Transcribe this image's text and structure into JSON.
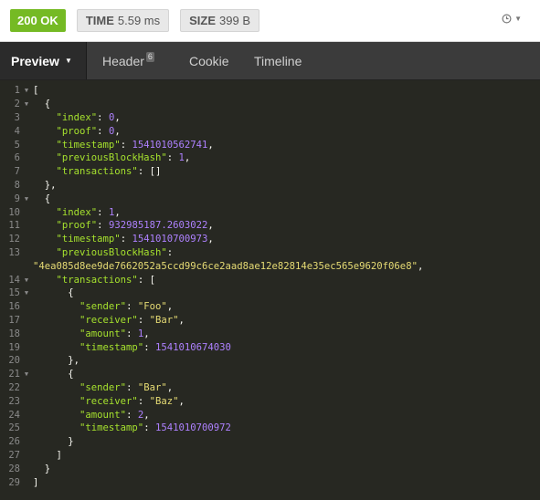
{
  "status": {
    "code_label": "200 OK"
  },
  "time": {
    "label": "TIME",
    "value": "5.59 ms"
  },
  "size": {
    "label": "SIZE",
    "value": "399 B"
  },
  "history_icon": "clock-icon",
  "tabs": {
    "preview": "Preview",
    "header": "Header",
    "header_count": "6",
    "cookie": "Cookie",
    "timeline": "Timeline"
  },
  "colors": {
    "status_ok": "#75ba24",
    "key": "#a6e22e",
    "number": "#ae81ff",
    "string": "#e6db74",
    "background": "#272822"
  },
  "json_lines": [
    {
      "n": "1",
      "fold": true,
      "t": [
        [
          "p",
          "["
        ]
      ]
    },
    {
      "n": "2",
      "fold": true,
      "t": [
        [
          "p",
          "  {"
        ]
      ]
    },
    {
      "n": "3",
      "fold": false,
      "t": [
        [
          "p",
          "    "
        ],
        [
          "k",
          "\"index\""
        ],
        [
          "p",
          ": "
        ],
        [
          "n",
          "0"
        ],
        [
          "p",
          ","
        ]
      ]
    },
    {
      "n": "4",
      "fold": false,
      "t": [
        [
          "p",
          "    "
        ],
        [
          "k",
          "\"proof\""
        ],
        [
          "p",
          ": "
        ],
        [
          "n",
          "0"
        ],
        [
          "p",
          ","
        ]
      ]
    },
    {
      "n": "5",
      "fold": false,
      "t": [
        [
          "p",
          "    "
        ],
        [
          "k",
          "\"timestamp\""
        ],
        [
          "p",
          ": "
        ],
        [
          "n",
          "1541010562741"
        ],
        [
          "p",
          ","
        ]
      ]
    },
    {
      "n": "6",
      "fold": false,
      "t": [
        [
          "p",
          "    "
        ],
        [
          "k",
          "\"previousBlockHash\""
        ],
        [
          "p",
          ": "
        ],
        [
          "n",
          "1"
        ],
        [
          "p",
          ","
        ]
      ]
    },
    {
      "n": "7",
      "fold": false,
      "t": [
        [
          "p",
          "    "
        ],
        [
          "k",
          "\"transactions\""
        ],
        [
          "p",
          ": []"
        ]
      ]
    },
    {
      "n": "8",
      "fold": false,
      "t": [
        [
          "p",
          "  },"
        ]
      ]
    },
    {
      "n": "9",
      "fold": true,
      "t": [
        [
          "p",
          "  {"
        ]
      ]
    },
    {
      "n": "10",
      "fold": false,
      "t": [
        [
          "p",
          "    "
        ],
        [
          "k",
          "\"index\""
        ],
        [
          "p",
          ": "
        ],
        [
          "n",
          "1"
        ],
        [
          "p",
          ","
        ]
      ]
    },
    {
      "n": "11",
      "fold": false,
      "t": [
        [
          "p",
          "    "
        ],
        [
          "k",
          "\"proof\""
        ],
        [
          "p",
          ": "
        ],
        [
          "n",
          "932985187.2603022"
        ],
        [
          "p",
          ","
        ]
      ]
    },
    {
      "n": "12",
      "fold": false,
      "t": [
        [
          "p",
          "    "
        ],
        [
          "k",
          "\"timestamp\""
        ],
        [
          "p",
          ": "
        ],
        [
          "n",
          "1541010700973"
        ],
        [
          "p",
          ","
        ]
      ]
    },
    {
      "n": "13",
      "fold": false,
      "t": [
        [
          "p",
          "    "
        ],
        [
          "k",
          "\"previousBlockHash\""
        ],
        [
          "p",
          ":"
        ]
      ]
    },
    {
      "n": "",
      "fold": false,
      "t": [
        [
          "s",
          "\"4ea085d8ee9de7662052a5ccd99c6ce2aad8ae12e82814e35ec565e9620f06e8\""
        ],
        [
          "p",
          ","
        ]
      ]
    },
    {
      "n": "14",
      "fold": true,
      "t": [
        [
          "p",
          "    "
        ],
        [
          "k",
          "\"transactions\""
        ],
        [
          "p",
          ": ["
        ]
      ]
    },
    {
      "n": "15",
      "fold": true,
      "t": [
        [
          "p",
          "      {"
        ]
      ]
    },
    {
      "n": "16",
      "fold": false,
      "t": [
        [
          "p",
          "        "
        ],
        [
          "k",
          "\"sender\""
        ],
        [
          "p",
          ": "
        ],
        [
          "s",
          "\"Foo\""
        ],
        [
          "p",
          ","
        ]
      ]
    },
    {
      "n": "17",
      "fold": false,
      "t": [
        [
          "p",
          "        "
        ],
        [
          "k",
          "\"receiver\""
        ],
        [
          "p",
          ": "
        ],
        [
          "s",
          "\"Bar\""
        ],
        [
          "p",
          ","
        ]
      ]
    },
    {
      "n": "18",
      "fold": false,
      "t": [
        [
          "p",
          "        "
        ],
        [
          "k",
          "\"amount\""
        ],
        [
          "p",
          ": "
        ],
        [
          "n",
          "1"
        ],
        [
          "p",
          ","
        ]
      ]
    },
    {
      "n": "19",
      "fold": false,
      "t": [
        [
          "p",
          "        "
        ],
        [
          "k",
          "\"timestamp\""
        ],
        [
          "p",
          ": "
        ],
        [
          "n",
          "1541010674030"
        ]
      ]
    },
    {
      "n": "20",
      "fold": false,
      "t": [
        [
          "p",
          "      },"
        ]
      ]
    },
    {
      "n": "21",
      "fold": true,
      "t": [
        [
          "p",
          "      {"
        ]
      ]
    },
    {
      "n": "22",
      "fold": false,
      "t": [
        [
          "p",
          "        "
        ],
        [
          "k",
          "\"sender\""
        ],
        [
          "p",
          ": "
        ],
        [
          "s",
          "\"Bar\""
        ],
        [
          "p",
          ","
        ]
      ]
    },
    {
      "n": "23",
      "fold": false,
      "t": [
        [
          "p",
          "        "
        ],
        [
          "k",
          "\"receiver\""
        ],
        [
          "p",
          ": "
        ],
        [
          "s",
          "\"Baz\""
        ],
        [
          "p",
          ","
        ]
      ]
    },
    {
      "n": "24",
      "fold": false,
      "t": [
        [
          "p",
          "        "
        ],
        [
          "k",
          "\"amount\""
        ],
        [
          "p",
          ": "
        ],
        [
          "n",
          "2"
        ],
        [
          "p",
          ","
        ]
      ]
    },
    {
      "n": "25",
      "fold": false,
      "t": [
        [
          "p",
          "        "
        ],
        [
          "k",
          "\"timestamp\""
        ],
        [
          "p",
          ": "
        ],
        [
          "n",
          "1541010700972"
        ]
      ]
    },
    {
      "n": "26",
      "fold": false,
      "t": [
        [
          "p",
          "      }"
        ]
      ]
    },
    {
      "n": "27",
      "fold": false,
      "t": [
        [
          "p",
          "    ]"
        ]
      ]
    },
    {
      "n": "28",
      "fold": false,
      "t": [
        [
          "p",
          "  }"
        ]
      ]
    },
    {
      "n": "29",
      "fold": false,
      "t": [
        [
          "p",
          "]"
        ]
      ]
    }
  ]
}
